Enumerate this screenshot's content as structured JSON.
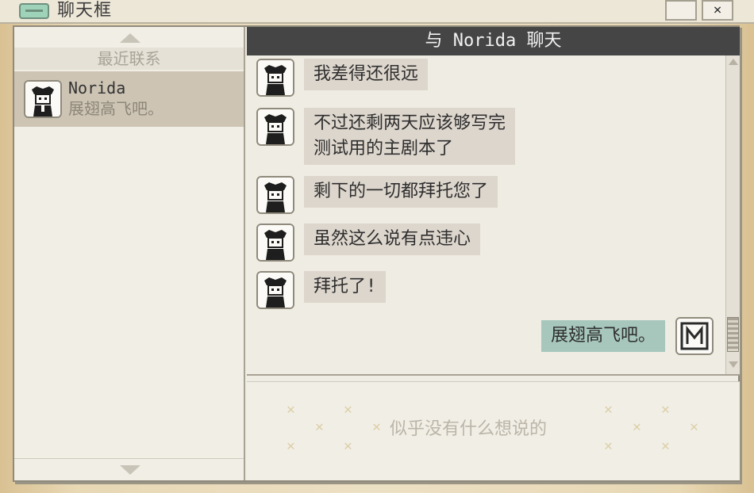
{
  "window": {
    "title": "聊天框",
    "close_label": "×"
  },
  "sidebar": {
    "heading": "最近联系",
    "contacts": [
      {
        "name": "Norida",
        "preview": "展翅高飞吧。"
      }
    ]
  },
  "chat": {
    "header": "与 Norida 聊天",
    "messages": [
      {
        "from": "Norida",
        "text": "我差得还很远"
      },
      {
        "from": "Norida",
        "text": "不过还剩两天应该够写完\n测试用的主剧本了"
      },
      {
        "from": "Norida",
        "text": "剩下的一切都拜托您了"
      },
      {
        "from": "Norida",
        "text": "虽然这么说有点违心"
      },
      {
        "from": "Norida",
        "text": "拜托了!"
      },
      {
        "from": "me",
        "text": "展翅高飞吧。"
      }
    ],
    "input_placeholder": "似乎没有什么想说的"
  },
  "colors": {
    "header_bg": "#454545",
    "incoming_bubble": "#ddd6cd",
    "outgoing_bubble": "#a7c7bd",
    "selected_contact": "#cdc4b4"
  },
  "icons": {
    "app": "chat-window-icon",
    "contact_avatar": "norida-avatar-icon",
    "user_avatar": "user-avatar-icon"
  }
}
